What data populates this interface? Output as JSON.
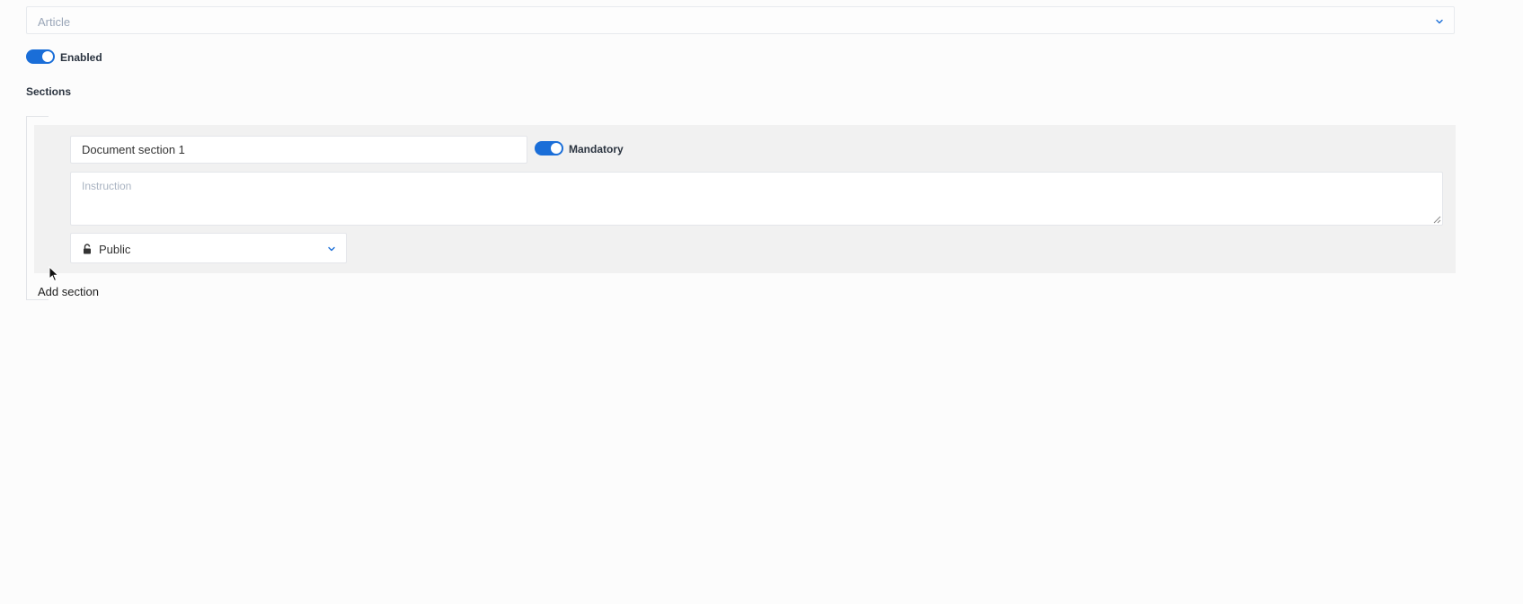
{
  "document_type": {
    "value": "Article",
    "icon": "chevron-down-icon"
  },
  "enabled_toggle": {
    "label": "Enabled",
    "on": true
  },
  "sections": {
    "heading": "Sections",
    "items": [
      {
        "name": "Document section 1",
        "mandatory_label": "Mandatory",
        "mandatory_on": true,
        "instruction_placeholder": "Instruction",
        "instruction_value": "",
        "visibility": {
          "value": "Public",
          "icon": "unlock-icon"
        }
      }
    ],
    "add_label": "Add section"
  },
  "colors": {
    "accent": "#1a6ed8",
    "section_background": "#f1f1f1",
    "page_background": "#fcfcfc",
    "placeholder_text": "#9aa6b8"
  }
}
